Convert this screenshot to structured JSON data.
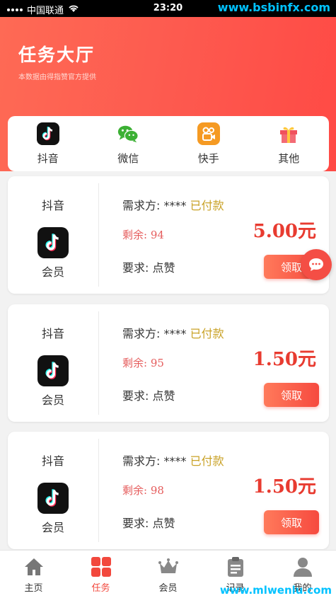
{
  "statusbar": {
    "carrier": "中国联通",
    "time": "23:20",
    "watermark": "www.bsbinfx.com"
  },
  "header": {
    "title": "任务大厅",
    "subtitle": "本数据由得指赞官方提供"
  },
  "platforms": [
    {
      "label": "抖音",
      "icon": "douyin-icon"
    },
    {
      "label": "微信",
      "icon": "wechat-icon"
    },
    {
      "label": "快手",
      "icon": "kuaishou-icon"
    },
    {
      "label": "其他",
      "icon": "gift-icon"
    }
  ],
  "tasks": [
    {
      "platform": "抖音",
      "member": "会员",
      "demand_label": "需求方: ****",
      "status": "已付款",
      "remain": "剩余: 94",
      "price": "5.00元",
      "requirement": "要求: 点赞",
      "button": "领取"
    },
    {
      "platform": "抖音",
      "member": "会员",
      "demand_label": "需求方: ****",
      "status": "已付款",
      "remain": "剩余: 95",
      "price": "1.50元",
      "requirement": "要求: 点赞",
      "button": "领取"
    },
    {
      "platform": "抖音",
      "member": "会员",
      "demand_label": "需求方: ****",
      "status": "已付款",
      "remain": "剩余: 98",
      "price": "1.50元",
      "requirement": "要求: 点赞",
      "button": "领取"
    }
  ],
  "tabbar": [
    {
      "label": "主页",
      "icon": "home-icon",
      "active": false
    },
    {
      "label": "任务",
      "icon": "grid-icon",
      "active": true
    },
    {
      "label": "会员",
      "icon": "crown-icon",
      "active": false
    },
    {
      "label": "记录",
      "icon": "clipboard-icon",
      "active": false
    },
    {
      "label": "我的",
      "icon": "user-icon",
      "active": false
    }
  ],
  "bottom_watermark": "www.mlwenlu.com",
  "colors": {
    "accent": "#f64a3f",
    "paid": "#c9a227",
    "header_gradient_start": "#fe6a55",
    "header_gradient_end": "#ff4a45"
  }
}
